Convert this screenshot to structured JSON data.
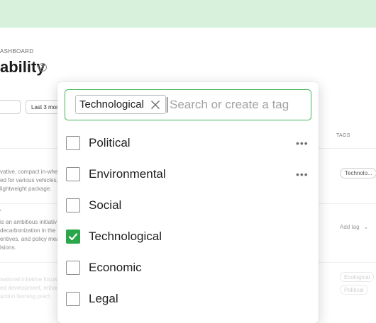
{
  "background": {
    "breadcrumb": "ASHBOARD",
    "title": "ability",
    "help_icon": "question-circle-icon",
    "date_button": "Last 3 mon",
    "column_tags": "TAGS",
    "rows": [
      {
        "desc_lines": [
          "vative, compact in-whee",
          "ed for various vehicles, ",
          "lightweight package."
        ],
        "tag": "Technolo..."
      },
      {
        "desc_lines": [
          "is an ambitious initiativ",
          "decarbonization in the s",
          "entives, and policy mea",
          "isions."
        ],
        "add_tag": "Add tag"
      },
      {
        "desc_lines": [
          "national initiative focus",
          "ed development, enhanc",
          "uction farming pract"
        ],
        "tags": [
          "Ecological",
          "Political"
        ]
      }
    ]
  },
  "dropdown": {
    "selected_chip": "Technological",
    "search_placeholder": "Search or create a tag",
    "accent_color": "#2aa74a",
    "options": [
      {
        "label": "Political",
        "checked": false,
        "has_more": true
      },
      {
        "label": "Environmental",
        "checked": false,
        "has_more": true
      },
      {
        "label": "Social",
        "checked": false,
        "has_more": false
      },
      {
        "label": "Technological",
        "checked": true,
        "has_more": false
      },
      {
        "label": "Economic",
        "checked": false,
        "has_more": false
      },
      {
        "label": "Legal",
        "checked": false,
        "has_more": false
      }
    ],
    "more_glyph": "•••"
  }
}
